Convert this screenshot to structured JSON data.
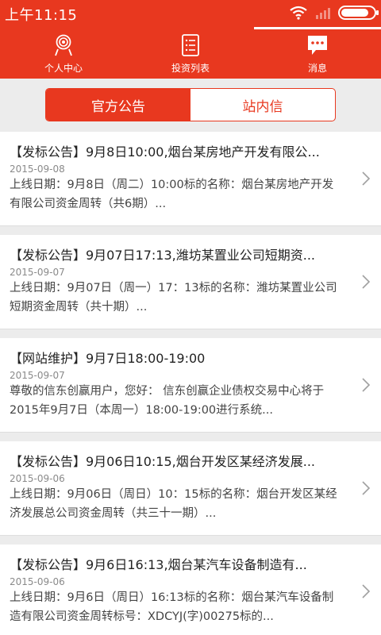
{
  "status_bar": {
    "time": "上午11:15",
    "signal_level": 0,
    "battery_level": 0.85
  },
  "top_nav": {
    "items": [
      {
        "label": "个人中心",
        "icon": "user-center-icon"
      },
      {
        "label": "投资列表",
        "icon": "list-document-icon"
      },
      {
        "label": "消息",
        "icon": "message-bubble-icon"
      }
    ],
    "active_index": 2
  },
  "segments": {
    "official": "官方公告",
    "site_mail": "站内信",
    "active": "official"
  },
  "announcements": [
    {
      "title": "【发标公告】9月8日10:00,烟台某房地产开发有限公...",
      "date": "2015-09-08",
      "summary": "上线日期：9月8日（周二）10:00标的名称：烟台某房地产开发有限公司资金周转（共6期）..."
    },
    {
      "title": "【发标公告】9月07日17:13,潍坊某置业公司短期资...",
      "date": "2015-09-07",
      "summary": "上线日期：9月07日（周一）17：13标的名称：潍坊某置业公司短期资金周转（共十期）..."
    },
    {
      "title": "【网站维护】9月7日18:00-19:00",
      "date": "2015-09-07",
      "summary": "尊敬的信东创赢用户，您好： 信东创赢企业债权交易中心将于2015年9月7日（本周一）18:00-19:00进行系统..."
    },
    {
      "title": "【发标公告】9月06日10:15,烟台开发区某经济发展...",
      "date": "2015-09-06",
      "summary": "上线日期：9月06日（周日）10：15标的名称：烟台开发区某经济发展总公司资金周转（共三十一期）..."
    },
    {
      "title": "【发标公告】9月6日16:13,烟台某汽车设备制造有...",
      "date": "2015-09-06",
      "summary": "上线日期：9月6日（周日）16:13标的名称：烟台某汽车设备制造有限公司资金周转标号：XDCYJ(字)00275标的..."
    }
  ],
  "colors": {
    "accent": "#e8381f",
    "background": "#ececec"
  }
}
